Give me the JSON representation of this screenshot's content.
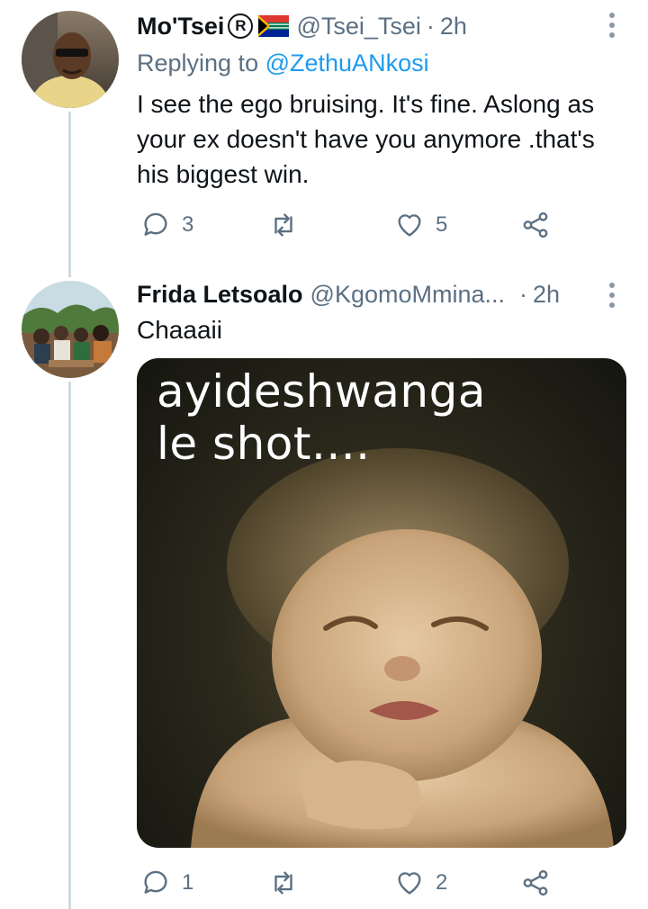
{
  "tweets": [
    {
      "display_name": "Mo'Tsei",
      "handle": "@Tsei_Tsei",
      "separator": "·",
      "time": "2h",
      "replying_prefix": "Replying to",
      "replying_to": "@ZethuANkosi",
      "text_lines": [
        "I see the ego bruising. It's fine. Aslong as",
        "your ex doesn't have you anymore .that's",
        "his biggest win."
      ],
      "reply_count": "3",
      "retweet_count": "",
      "like_count": "5"
    },
    {
      "display_name": "Frida Letsoalo",
      "handle": "@KgomoMmina...",
      "separator": "·",
      "time": "2h",
      "text_lines": [
        "Chaaaii"
      ],
      "media_caption_lines": [
        "ayideshwanga",
        "le shot...."
      ],
      "reply_count": "1",
      "retweet_count": "",
      "like_count": "2"
    }
  ],
  "icons": {
    "reply": "reply-icon",
    "retweet": "retweet-icon",
    "like": "heart-icon",
    "share": "share-icon",
    "more": "more-icon"
  },
  "colors": {
    "text": "#0f1419",
    "secondary": "#5b7083",
    "link": "#1d9bf0",
    "thread_line": "#cfd9de"
  }
}
